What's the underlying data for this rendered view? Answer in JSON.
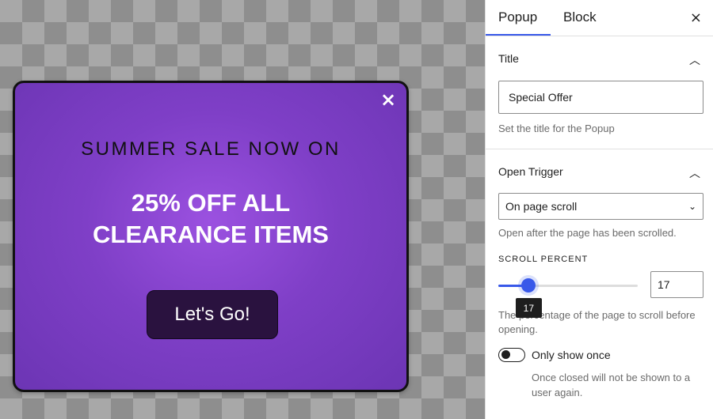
{
  "popup": {
    "close_icon": "×",
    "heading": "SUMMER SALE NOW ON",
    "offer": "25% OFF ALL\nCLEARANCE ITEMS",
    "cta_label": "Let's Go!",
    "colors": {
      "background": "#7f3fc7",
      "button": "#2a123f",
      "border": "#111111"
    }
  },
  "sidebar": {
    "tabs": [
      {
        "label": "Popup",
        "active": true
      },
      {
        "label": "Block",
        "active": false
      }
    ],
    "close_icon": "×",
    "title_panel": {
      "heading": "Title",
      "chevron": "︿",
      "value": "Special Offer",
      "help": "Set the title for the Popup"
    },
    "trigger_panel": {
      "heading": "Open Trigger",
      "chevron": "︿",
      "select_value": "On page scroll",
      "select_caret": "⌄",
      "help": "Open after the page has been scrolled.",
      "scroll_label": "SCROLL PERCENT",
      "scroll_value": "17",
      "scroll_fraction": 0.17,
      "tooltip": "17",
      "scroll_help": "The percentage of the page to scroll before opening.",
      "toggle_label": "Only show once",
      "toggle_on": false,
      "toggle_help": "Once closed will not be shown to a user again."
    },
    "accent": "#3858e9"
  }
}
